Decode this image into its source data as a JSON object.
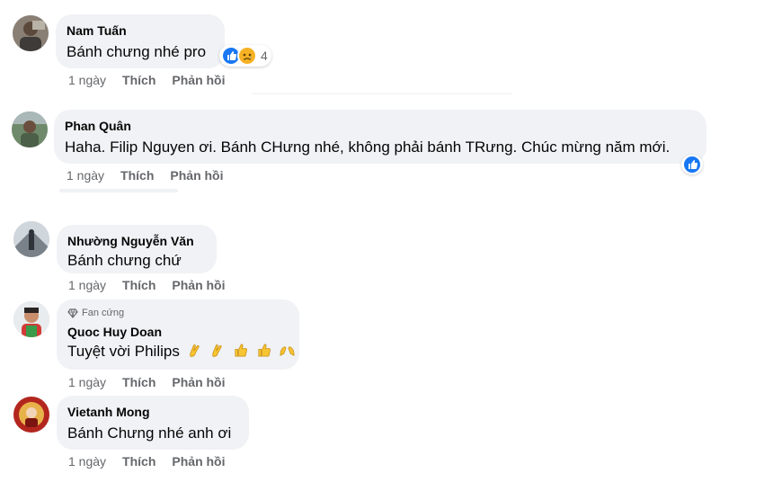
{
  "comments": [
    {
      "author": "Nam Tuấn",
      "text": "Bánh chưng nhé pro",
      "time": "1 ngày",
      "like": "Thích",
      "reply": "Phản hồi",
      "reactions": {
        "icons": [
          "like-icon",
          "sad-icon"
        ],
        "count": "4"
      }
    },
    {
      "author": "Phan Quân",
      "text": "Haha. Filip Nguyen ơi. Bánh CHưng nhé, không phải bánh TRưng. Chúc mừng năm mới.",
      "time": "1 ngày",
      "like": "Thích",
      "reply": "Phản hồi",
      "reactions": {
        "icons": [
          "like-icon"
        ]
      }
    },
    {
      "author": "Nhường Nguyễn Văn",
      "text": "Bánh chưng chứ",
      "time": "1 ngày",
      "like": "Thích",
      "reply": "Phản hồi"
    },
    {
      "badge": "Fan cứng",
      "author": "Quoc Huy Doan",
      "text": "Tuyệt vời Philips",
      "emojis": [
        "clapping-hands-icon",
        "clapping-hands-icon",
        "thumbs-up-icon",
        "thumbs-up-icon",
        "raising-hands-icon"
      ],
      "time": "1 ngày",
      "like": "Thích",
      "reply": "Phản hồi"
    },
    {
      "author": "Vietanh Mong",
      "text": "Bánh Chưng nhé anh ơi",
      "time": "1 ngày",
      "like": "Thích",
      "reply": "Phản hồi"
    }
  ],
  "colors": {
    "bubble": "#f0f2f5",
    "like_blue": "#1877f2",
    "meta_gray": "#65676b",
    "sad_yellow": "#f7b125"
  }
}
